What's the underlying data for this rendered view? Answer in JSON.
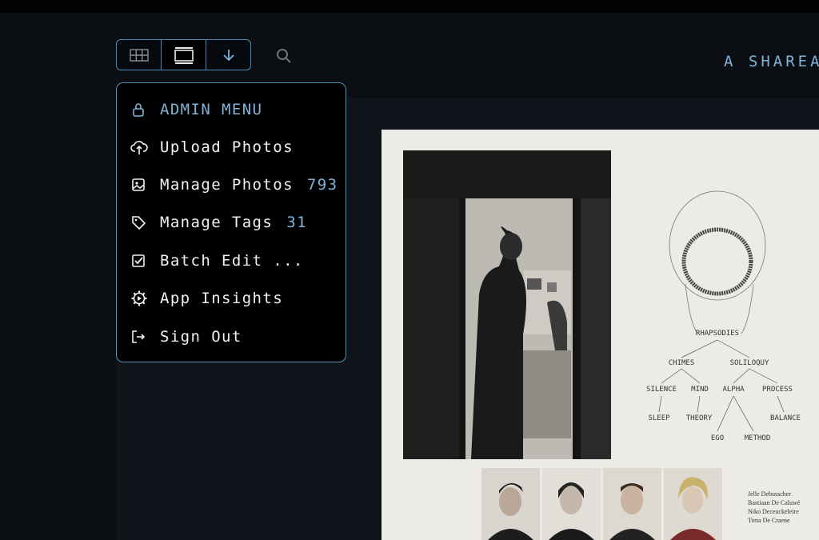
{
  "header": {
    "title": "A SHAREAB"
  },
  "view_switcher": {
    "items": [
      {
        "icon": "grid-icon",
        "label": "Grid view"
      },
      {
        "icon": "full-frame-icon",
        "label": "Full frame view",
        "active": true
      },
      {
        "icon": "arrow-down-icon",
        "label": "Admin menu"
      }
    ],
    "search_icon": "search-icon"
  },
  "admin_menu": {
    "header": {
      "icon": "lock-icon",
      "label": "ADMIN MENU"
    },
    "items": [
      {
        "icon": "upload-cloud-icon",
        "label": "Upload Photos",
        "count": ""
      },
      {
        "icon": "photos-icon",
        "label": "Manage Photos",
        "count": "793"
      },
      {
        "icon": "tag-icon",
        "label": "Manage Tags",
        "count": "31"
      },
      {
        "icon": "checkbox-icon",
        "label": "Batch Edit ...",
        "count": ""
      },
      {
        "icon": "gear-icon",
        "label": "App Insights",
        "count": ""
      },
      {
        "icon": "sign-out-icon",
        "label": "Sign Out",
        "count": ""
      }
    ]
  },
  "photo_content": {
    "diagram_words": {
      "top": "RHAPSODIES",
      "l2a": "CHIMES",
      "l2b": "SOLILOQUY",
      "l3a": "SILENCE",
      "l3b": "MIND",
      "l3c": "ALPHA",
      "l3d": "PROCESS",
      "l4a": "SLEEP",
      "l4b": "THEORY",
      "l4c": "BALANCE",
      "l5a": "EGO",
      "l5b": "METHOD"
    },
    "captions": [
      "Jelle Debusscher",
      "Bastiaan De Caluwé",
      "Niko Deceuckeleire",
      "Tima De Craene"
    ]
  },
  "colors": {
    "accent": "#7fb3d8",
    "border": "#5e8fb3",
    "menu_bg": "#000000",
    "page_bg": "#0b0e12"
  }
}
